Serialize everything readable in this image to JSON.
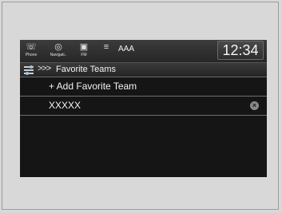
{
  "shortcuts": [
    {
      "label": "Phone",
      "icon": "phone-icon",
      "glyph": "☏"
    },
    {
      "label": "Navigati..",
      "icon": "navigation-icon",
      "glyph": "◎"
    },
    {
      "label": "FM",
      "icon": "radio-icon",
      "glyph": "▣"
    },
    {
      "label": "",
      "icon": "siriusxm-icon",
      "glyph": "≡"
    }
  ],
  "source_label": "AAA",
  "clock": "12:34",
  "titlebar": {
    "arrows": ">>>",
    "title": "Favorite Teams"
  },
  "list": {
    "add_label": "+ Add Favorite Team",
    "team_label": "XXXXX"
  },
  "icons": {
    "delete_glyph": "×"
  },
  "colors": {
    "screen_bg": "#151515",
    "text": "#f4f4f4",
    "divider": "#6f6f6f"
  }
}
